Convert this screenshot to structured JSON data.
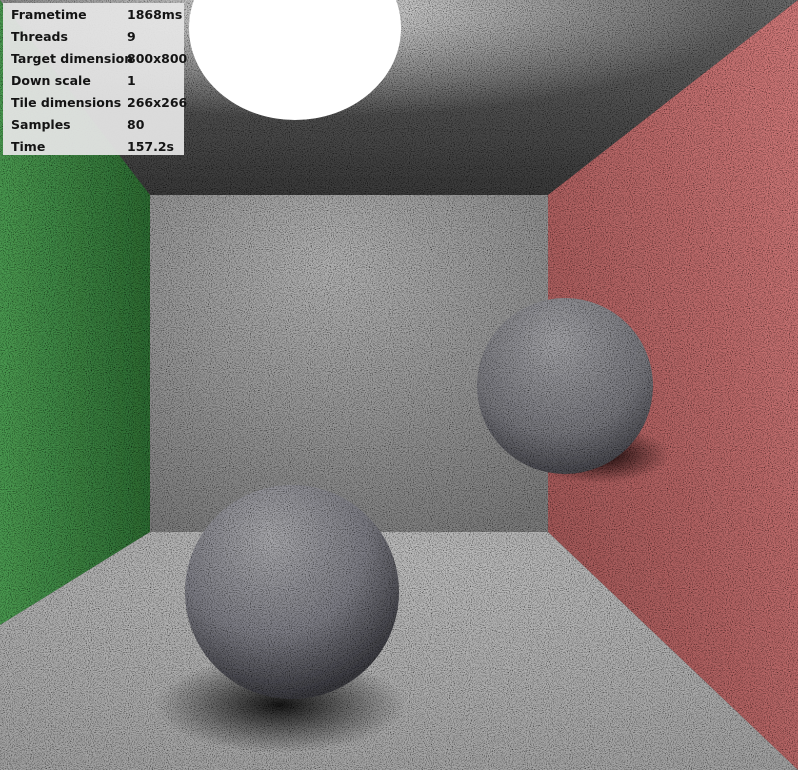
{
  "stats": [
    {
      "label": "Frametime",
      "value": "1868ms"
    },
    {
      "label": "Threads",
      "value": "9"
    },
    {
      "label": "Target dimension",
      "value": "800x800"
    },
    {
      "label": "Down scale",
      "value": "1"
    },
    {
      "label": "Tile dimensions",
      "value": "266x266"
    },
    {
      "label": "Samples",
      "value": "80"
    },
    {
      "label": "Time",
      "value": "157.2s"
    }
  ],
  "scene": {
    "colors": {
      "left_wall": "#3f8c45",
      "right_wall": "#c86f6f",
      "back_wall": "#a9a9a9",
      "floor": "#b5b5b5",
      "ceiling": "#5a5a5a",
      "light": "#ffffff",
      "sphere": "#8a8a8f"
    }
  }
}
